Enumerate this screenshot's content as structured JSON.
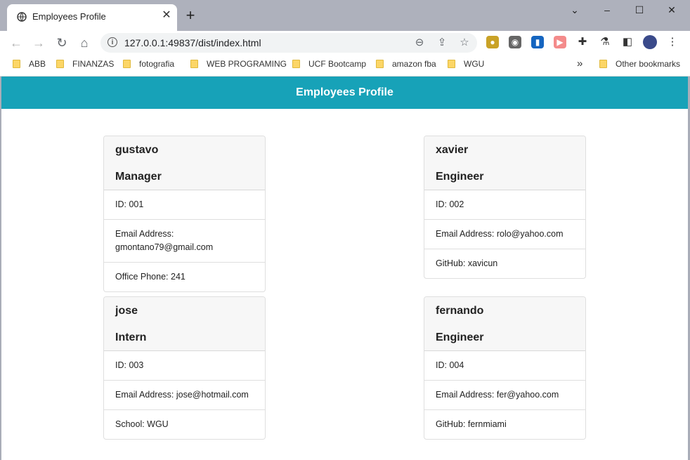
{
  "browser": {
    "tab_title": "Employees Profile",
    "url": "127.0.0.1:49837/dist/index.html",
    "bookmarks": [
      "ABB",
      "FINANZAS",
      "fotografia",
      "WEB PROGRAMING",
      "UCF Bootcamp",
      "amazon fba",
      "WGU"
    ],
    "other_bookmarks": "Other bookmarks",
    "overflow": "»"
  },
  "page": {
    "header": "Employees Profile",
    "employees": [
      {
        "name": "gustavo",
        "role": "Manager",
        "id": "ID: 001",
        "email": "Email Address: gmontano79@gmail.com",
        "extra": "Office Phone: 241"
      },
      {
        "name": "xavier",
        "role": "Engineer",
        "id": "ID: 002",
        "email": "Email Address: rolo@yahoo.com",
        "extra": "GitHub: xavicun"
      },
      {
        "name": "jose",
        "role": "Intern",
        "id": "ID: 003",
        "email": "Email Address: jose@hotmail.com",
        "extra": "School: WGU"
      },
      {
        "name": "fernando",
        "role": "Engineer",
        "id": "ID: 004",
        "email": "Email Address: fer@yahoo.com",
        "extra": "GitHub: fernmiami"
      }
    ]
  }
}
